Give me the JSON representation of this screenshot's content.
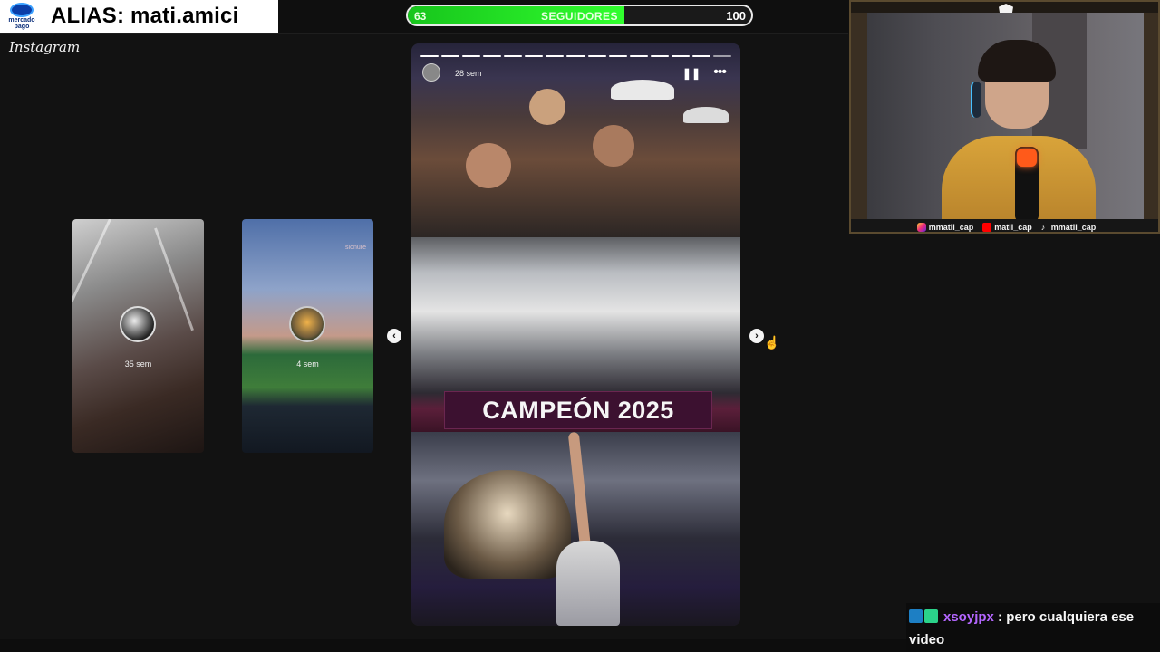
{
  "alias_banner": {
    "brand_line1": "mercado",
    "brand_line2": "pago",
    "alias": "ALIAS: mati.amici"
  },
  "instagram_label": "Instagram",
  "followers_goal": {
    "current": "63",
    "label": "SEGUIDORES",
    "target": "100",
    "progress_fraction": 0.63
  },
  "story_viewer": {
    "thumbnails": [
      {
        "time": "35 sem"
      },
      {
        "time": "4 sem",
        "brand": "slonure"
      }
    ],
    "active_story": {
      "time": "28 sem",
      "banner_text": "CAMPEÓN 2025",
      "progress_segments": 15,
      "segments_done": 14
    },
    "nav": {
      "prev": "‹",
      "next": "›"
    }
  },
  "webcam": {
    "socials": [
      {
        "icon": "instagram-icon",
        "handle": "mmatii_cap"
      },
      {
        "icon": "youtube-icon",
        "handle": "matii_cap"
      },
      {
        "icon": "tiktok-icon",
        "handle": "mmatii_cap"
      }
    ]
  },
  "chat": {
    "username": "xsoyjpx",
    "message": ": pero cualquiera ese video"
  },
  "colors": {
    "progress_green": "#31ff2e",
    "banner_maroon": "#3c1130",
    "chat_username": "#b466ff",
    "brand_blue": "#0b3ea8"
  }
}
